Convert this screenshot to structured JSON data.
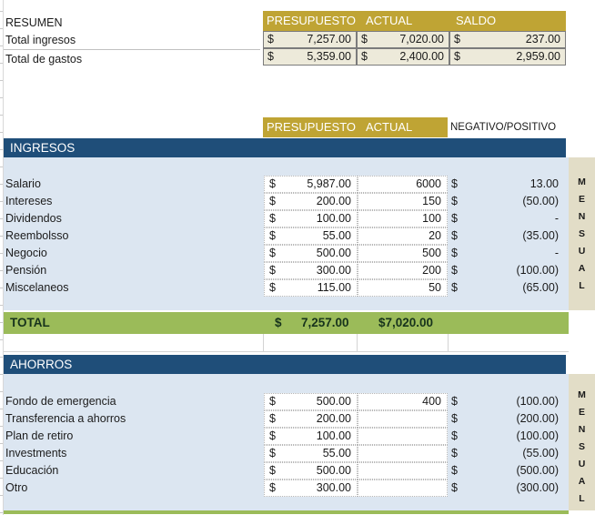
{
  "summary": {
    "title": "RESUMEN",
    "headers": {
      "budget": "PRESUPUESTO",
      "actual": "ACTUAL",
      "balance": "SALDO"
    },
    "rows": [
      {
        "label": "Total ingresos",
        "budget_cur": "$",
        "budget": "7,257.00",
        "actual_cur": "$",
        "actual": "7,020.00",
        "balance_cur": "$",
        "balance": "237.00"
      },
      {
        "label": "Total de gastos",
        "budget_cur": "$",
        "budget": "5,359.00",
        "actual_cur": "$",
        "actual": "2,400.00",
        "balance_cur": "$",
        "balance": "2,959.00"
      }
    ]
  },
  "table_headers": {
    "budget": "PRESUPUESTO",
    "actual": "ACTUAL",
    "negpos": "NEGATIVO/POSITIVO"
  },
  "income": {
    "section_title": "INGRESOS",
    "side_label": "MENSUAL",
    "rows": [
      {
        "label": "Salario",
        "budget_cur": "$",
        "budget": "5,987.00",
        "actual": "6000",
        "diff_cur": "$",
        "diff": "13.00"
      },
      {
        "label": "Intereses",
        "budget_cur": "$",
        "budget": "200.00",
        "actual": "150",
        "diff_cur": "$",
        "diff": "(50.00)"
      },
      {
        "label": "Dividendos",
        "budget_cur": "$",
        "budget": "100.00",
        "actual": "100",
        "diff_cur": "$",
        "diff": "-"
      },
      {
        "label": "Reembolsso",
        "budget_cur": "$",
        "budget": "55.00",
        "actual": "20",
        "diff_cur": "$",
        "diff": "(35.00)"
      },
      {
        "label": "Negocio",
        "budget_cur": "$",
        "budget": "500.00",
        "actual": "500",
        "diff_cur": "$",
        "diff": "-"
      },
      {
        "label": "Pensión",
        "budget_cur": "$",
        "budget": "300.00",
        "actual": "200",
        "diff_cur": "$",
        "diff": "(100.00)"
      },
      {
        "label": "Miscelaneos",
        "budget_cur": "$",
        "budget": "115.00",
        "actual": "50",
        "diff_cur": "$",
        "diff": "(65.00)"
      }
    ],
    "total": {
      "label": "TOTAL",
      "budget_cur": "$",
      "budget": "7,257.00",
      "actual": "$7,020.00"
    }
  },
  "savings": {
    "section_title": "AHORROS",
    "side_label": "MENSUAL",
    "rows": [
      {
        "label": "Fondo de emergencia",
        "budget_cur": "$",
        "budget": "500.00",
        "actual": "400",
        "diff_cur": "$",
        "diff": "(100.00)"
      },
      {
        "label": "Transferencia a ahorros",
        "budget_cur": "$",
        "budget": "200.00",
        "actual": "",
        "diff_cur": "$",
        "diff": "(200.00)"
      },
      {
        "label": "Plan de retiro",
        "budget_cur": "$",
        "budget": "100.00",
        "actual": "",
        "diff_cur": "$",
        "diff": "(100.00)"
      },
      {
        "label": "Investments",
        "budget_cur": "$",
        "budget": "55.00",
        "actual": "",
        "diff_cur": "$",
        "diff": "(55.00)"
      },
      {
        "label": "Educación",
        "budget_cur": "$",
        "budget": "500.00",
        "actual": "",
        "diff_cur": "$",
        "diff": "(500.00)"
      },
      {
        "label": "Otro",
        "budget_cur": "$",
        "budget": "300.00",
        "actual": "",
        "diff_cur": "$",
        "diff": "(300.00)"
      }
    ]
  },
  "colors": {
    "gold": "#BFA434",
    "navy": "#1F4E79",
    "green": "#9BBB59",
    "band": "#DCE6F1",
    "mensual": "#E2DDC7",
    "summary_cell": "#EDEADA"
  }
}
